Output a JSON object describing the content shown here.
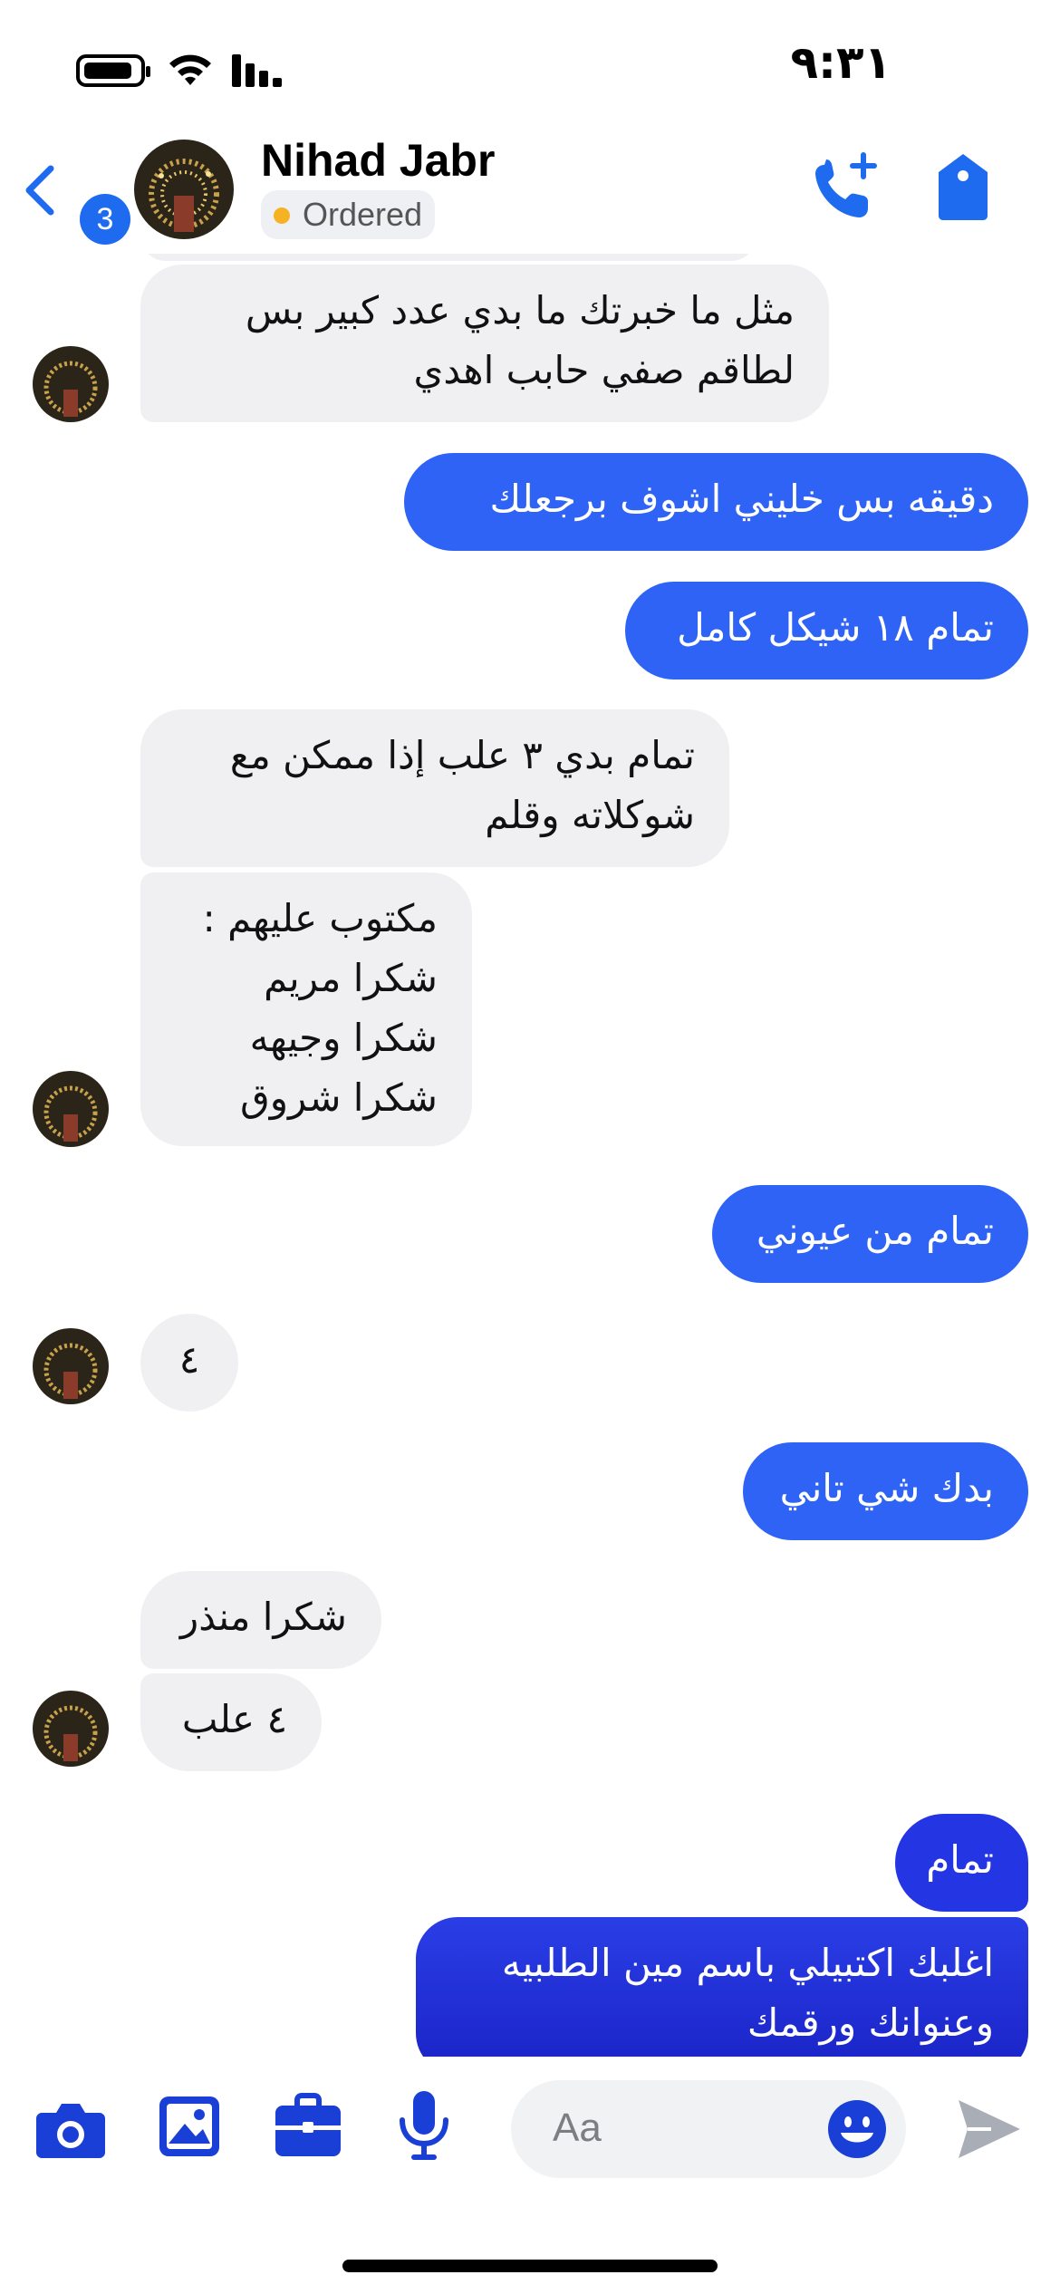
{
  "status_bar": {
    "time": "٩:٣١"
  },
  "header": {
    "unread_count": "3",
    "contact_name": "Nihad Jabr",
    "status_label": "Ordered",
    "colors": {
      "accent": "#1f6bf0",
      "status_dot": "#f5b324"
    }
  },
  "messages": [
    {
      "dir": "in",
      "text": "مثل ما خبرتك ما بدي عدد كبير بس\nلطاقم صفي حابب اهدي"
    },
    {
      "dir": "out",
      "text": "دقيقه بس خليني اشوف برجعلك"
    },
    {
      "dir": "out",
      "text": "تمام ١٨ شيكل كامل"
    },
    {
      "dir": "in",
      "text": "تمام بدي ٣ علب إذا ممكن مع\nشوكلاته وقلم"
    },
    {
      "dir": "in",
      "text": "مكتوب عليهم :\nشكرا مريم\nشكرا وجيهه\nشكرا شروق"
    },
    {
      "dir": "out",
      "text": "تمام من عيوني"
    },
    {
      "dir": "in",
      "text": "٤"
    },
    {
      "dir": "out",
      "text": "بدك شي تاني"
    },
    {
      "dir": "in",
      "text": "شكرا منذر"
    },
    {
      "dir": "in",
      "text": "٤ علب"
    },
    {
      "dir": "out",
      "text": "تمام"
    },
    {
      "dir": "out",
      "text": "اغلبك اكتبيلي باسم مين الطلبيه\nوعنوانك ورقمك"
    }
  ],
  "composer": {
    "placeholder": "Aa",
    "icons": [
      "camera-icon",
      "photo-icon",
      "briefcase-icon",
      "microphone-icon",
      "emoji-icon",
      "send-icon"
    ],
    "colors": {
      "icon": "#1a3fd6",
      "send": "#a9adb5"
    }
  },
  "colors": {
    "incoming_bubble": "#f0f0f3",
    "outgoing_bubble": "#2f63f5",
    "outgoing_bubble_dark": "#1a23c6"
  }
}
